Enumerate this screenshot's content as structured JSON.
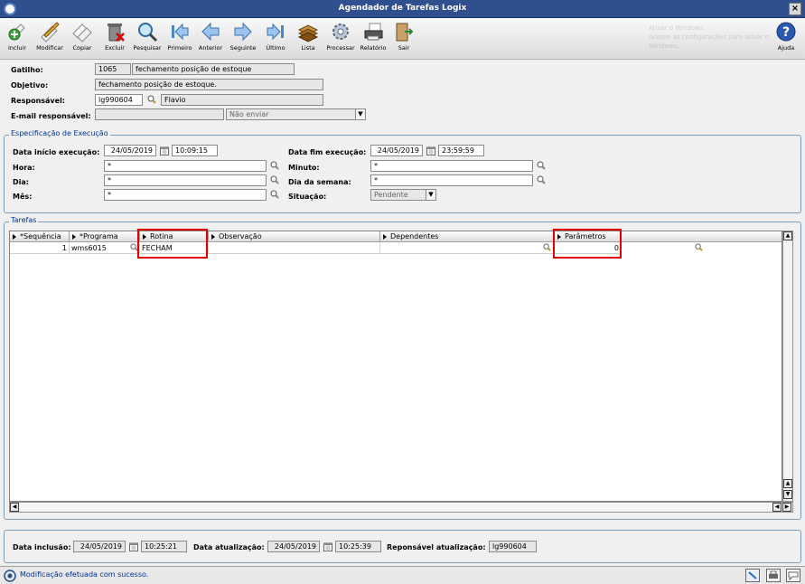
{
  "window": {
    "title": "Agendador de Tarefas Logix"
  },
  "toolbar": [
    {
      "label": "Incluir",
      "icon": "add-icon"
    },
    {
      "label": "Modificar",
      "icon": "edit-icon"
    },
    {
      "label": "Copiar",
      "icon": "copy-icon"
    },
    {
      "label": "Excluir",
      "icon": "trash-icon"
    },
    {
      "label": "Pesquisar",
      "icon": "search-icon"
    },
    {
      "label": "Primeiro",
      "icon": "first-icon"
    },
    {
      "label": "Anterior",
      "icon": "previous-icon"
    },
    {
      "label": "Seguinte",
      "icon": "next-icon"
    },
    {
      "label": "Último",
      "icon": "last-icon"
    },
    {
      "label": "Lista",
      "icon": "list-icon"
    },
    {
      "label": "Processar",
      "icon": "process-icon"
    },
    {
      "label": "Relatório",
      "icon": "report-icon"
    },
    {
      "label": "Sair",
      "icon": "exit-icon"
    },
    {
      "label": "Ajuda",
      "icon": "help-icon"
    }
  ],
  "watermark": {
    "line1": "Ativar o Windows",
    "line2": "Acesse as configurações para ativar o Windows."
  },
  "header": {
    "gatilho_label": "Gatilho:",
    "gatilho_code": "1065",
    "gatilho_desc": "fechamento posição de estoque",
    "objetivo_label": "Objetivo:",
    "objetivo_value": "fechamento posição de estoque.",
    "responsavel_label": "Responsável:",
    "responsavel_code": "lg990604",
    "responsavel_name": "Flavio",
    "email_label": "E-mail responsável:",
    "email_value": "",
    "email_option": "Não enviar"
  },
  "execucao": {
    "title": "Especificação de Execução",
    "inicio_label": "Data início execução:",
    "inicio_date": "24/05/2019",
    "inicio_time": "10:09:15",
    "fim_label": "Data fim execução:",
    "fim_date": "24/05/2019",
    "fim_time": "23:59:59",
    "hora_label": "Hora:",
    "hora_value": "*",
    "minuto_label": "Minuto:",
    "minuto_value": "*",
    "dia_label": "Dia:",
    "dia_value": "*",
    "dia_semana_label": "Dia da semana:",
    "dia_semana_value": "*",
    "mes_label": "Mês:",
    "mes_value": "*",
    "situacao_label": "Situação:",
    "situacao_value": "Pendente"
  },
  "tarefas": {
    "title": "Tarefas",
    "columns": [
      "*Sequência",
      "*Programa",
      "Rotina",
      "Observação",
      "Dependentes",
      "Parâmetros"
    ],
    "rows": [
      {
        "sequencia": "1",
        "programa": "wms6015",
        "rotina": "FECHAM",
        "observacao": "",
        "dependentes": "",
        "parametros": "0"
      }
    ]
  },
  "footer": {
    "inclusao_label": "Data inclusão:",
    "inclusao_date": "24/05/2019",
    "inclusao_time": "10:25:21",
    "atualizacao_label": "Data atualização:",
    "atualizacao_date": "24/05/2019",
    "atualizacao_time": "10:25:39",
    "resp_label": "Reponsável atualização:",
    "resp_value": "lg990604"
  },
  "status": {
    "message": "Modificação efetuada com sucesso."
  },
  "colors": {
    "titlebar": "#2f4f8f",
    "highlight": "#e00000",
    "group_title": "#003399"
  }
}
